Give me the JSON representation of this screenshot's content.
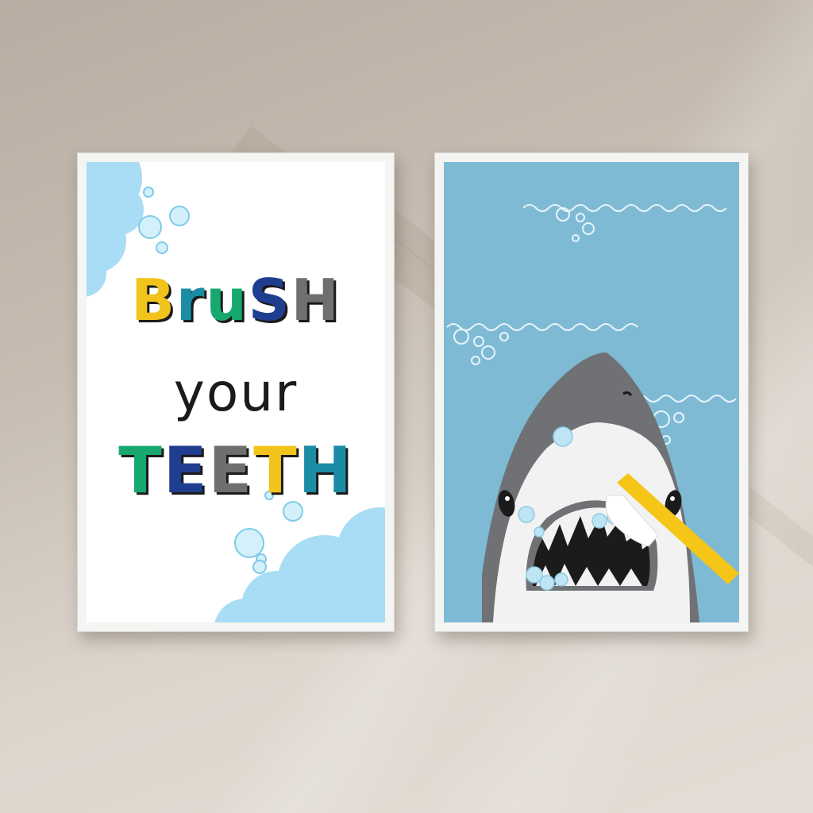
{
  "poster_left": {
    "line1": [
      "B",
      "r",
      "u",
      "S",
      "H"
    ],
    "line2": "your",
    "line3": [
      "T",
      "E",
      "E",
      "T",
      "H"
    ]
  },
  "colors": {
    "wall": "#d8d0c6",
    "frame": "#f4f4f2",
    "ocean": "#7fbad5",
    "shark_gray": "#6f7175",
    "toothbrush": "#f5c518",
    "cloud": "#a9dcf5"
  },
  "icons": [
    "bubble-icon",
    "cloud-icon",
    "shark-icon",
    "toothbrush-icon",
    "wave-icon"
  ]
}
